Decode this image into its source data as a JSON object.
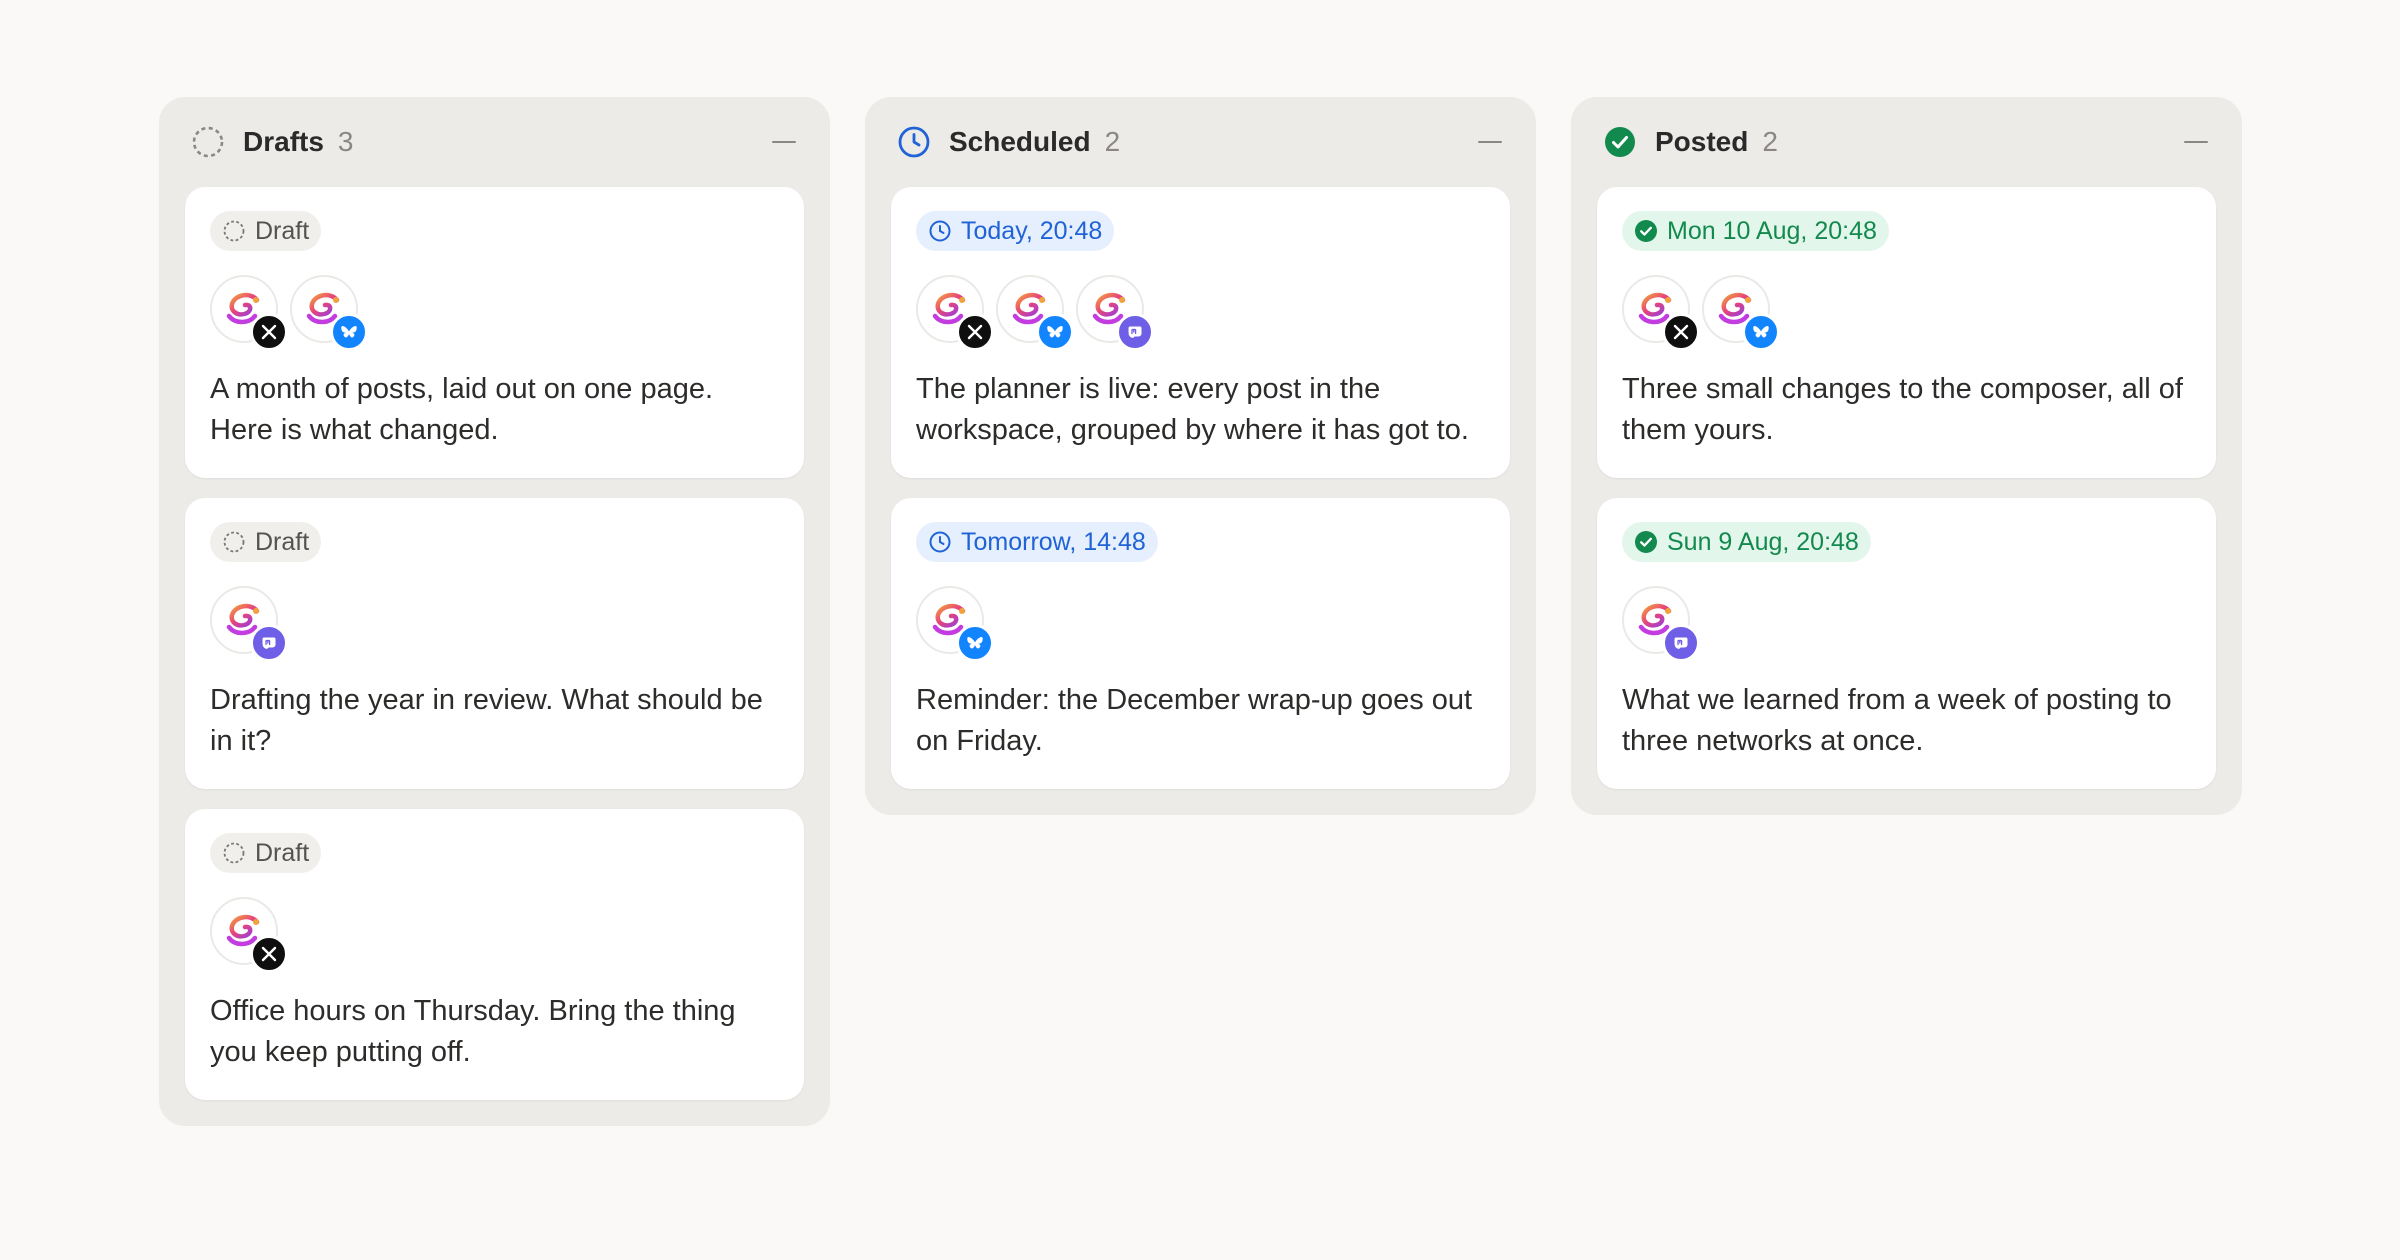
{
  "colors": {
    "page_bg": "#faf9f7",
    "column_bg": "#edebe8",
    "draft": "#8a8784",
    "scheduled": "#1f63d6",
    "posted": "#138a4d",
    "x": "#0f0f0f",
    "bluesky": "#1285fe",
    "mastodon": "#6f5fe6"
  },
  "columns": [
    {
      "title": "Drafts",
      "count": "3",
      "icon": "dashed-circle-icon",
      "cards": [
        {
          "label": "Draft",
          "icon": "dashed-circle-icon",
          "networks": [
            "x",
            "bluesky"
          ],
          "text": "A month of posts, laid out on one page. Here is what changed."
        },
        {
          "label": "Draft",
          "icon": "dashed-circle-icon",
          "networks": [
            "mastodon"
          ],
          "text": "Drafting the year in review. What should be in it?"
        },
        {
          "label": "Draft",
          "icon": "dashed-circle-icon",
          "networks": [
            "x"
          ],
          "text": "Office hours on Thursday. Bring the thing you keep putting off."
        }
      ]
    },
    {
      "title": "Scheduled",
      "count": "2",
      "icon": "clock-icon",
      "cards": [
        {
          "label": "Today, 20:48",
          "icon": "clock-icon",
          "networks": [
            "x",
            "bluesky",
            "mastodon"
          ],
          "text": "The planner is live: every post in the workspace, grouped by where it has got to."
        },
        {
          "label": "Tomorrow, 14:48",
          "icon": "clock-icon",
          "networks": [
            "bluesky"
          ],
          "text": "Reminder: the December wrap-up goes out on Friday."
        }
      ]
    },
    {
      "title": "Posted",
      "count": "2",
      "icon": "check-circle-icon",
      "cards": [
        {
          "label": "Mon 10 Aug, 20:48",
          "icon": "check-circle-icon",
          "networks": [
            "x",
            "bluesky"
          ],
          "text": "Three small changes to the composer, all of them yours."
        },
        {
          "label": "Sun 9 Aug, 20:48",
          "icon": "check-circle-icon",
          "networks": [
            "mastodon"
          ],
          "text": "What we learned from a week of posting to three networks at once."
        }
      ]
    }
  ]
}
